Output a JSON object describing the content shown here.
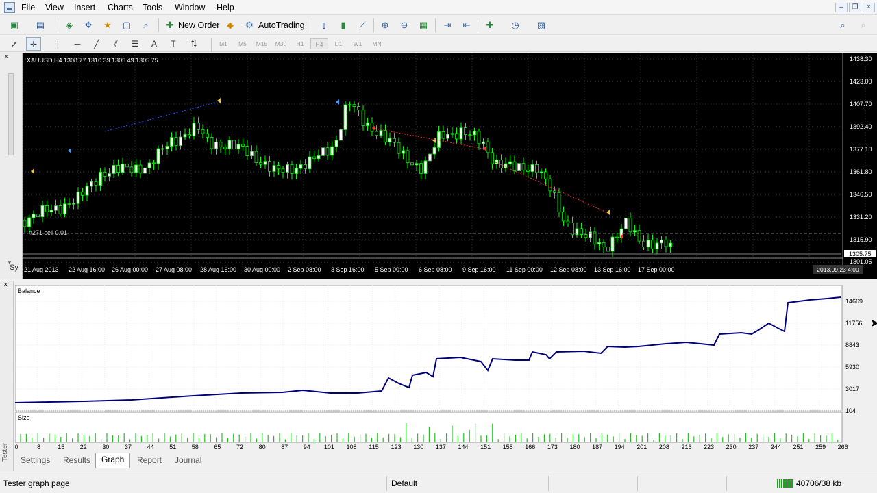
{
  "menu": [
    "File",
    "View",
    "Insert",
    "Charts",
    "Tools",
    "Window",
    "Help"
  ],
  "toolbar": {
    "new_order_label": "New Order",
    "autotrading_label": "AutoTrading"
  },
  "timeframes": [
    "M1",
    "M5",
    "M15",
    "M30",
    "H1",
    "H4",
    "D1",
    "W1",
    "MN"
  ],
  "chart": {
    "info": "XAUUSD,H4  1308.77 1310.39 1305.49 1305.75",
    "order_label": "#271 sell 0.01",
    "current_price": "1305.75",
    "price_labels": [
      "1438.30",
      "1423.00",
      "1407.70",
      "1392.40",
      "1377.10",
      "1361.80",
      "1346.50",
      "1331.20",
      "1315.90",
      "1301.05"
    ],
    "time_labels": [
      "21 Aug 2013",
      "22 Aug 16:00",
      "26 Aug 00:00",
      "27 Aug 08:00",
      "28 Aug 16:00",
      "30 Aug 00:00",
      "2 Sep 08:00",
      "3 Sep 16:00",
      "5 Sep 00:00",
      "6 Sep 08:00",
      "9 Sep 16:00",
      "11 Sep 00:00",
      "12 Sep 08:00",
      "13 Sep 16:00",
      "17 Sep 00:00"
    ],
    "cursor_time": "2013.09.23 4:00",
    "colors": {
      "background": "#000000",
      "bull_body": "#ffffff",
      "candle_line": "#00ff00",
      "grid": "#3a3a3a"
    }
  },
  "tester": {
    "balance_label": "Balance",
    "size_label": "Size",
    "balance_axis": [
      "14669",
      "11756",
      "8843",
      "5930",
      "3017",
      "104"
    ],
    "x_labels": [
      "0",
      "8",
      "15",
      "22",
      "30",
      "37",
      "44",
      "51",
      "58",
      "65",
      "72",
      "80",
      "87",
      "94",
      "101",
      "108",
      "115",
      "123",
      "130",
      "137",
      "144",
      "151",
      "158",
      "166",
      "173",
      "180",
      "187",
      "194",
      "201",
      "208",
      "216",
      "223",
      "230",
      "237",
      "244",
      "251",
      "259",
      "266"
    ],
    "tabs": [
      "Settings",
      "Results",
      "Graph",
      "Report",
      "Journal"
    ],
    "active_tab": "Graph",
    "side_label": "Tester",
    "balance_color": "#00007a",
    "size_color": "#1fc21f"
  },
  "status": {
    "left": "Tester graph page",
    "profile": "Default",
    "memory": "40706/38 kb"
  }
}
